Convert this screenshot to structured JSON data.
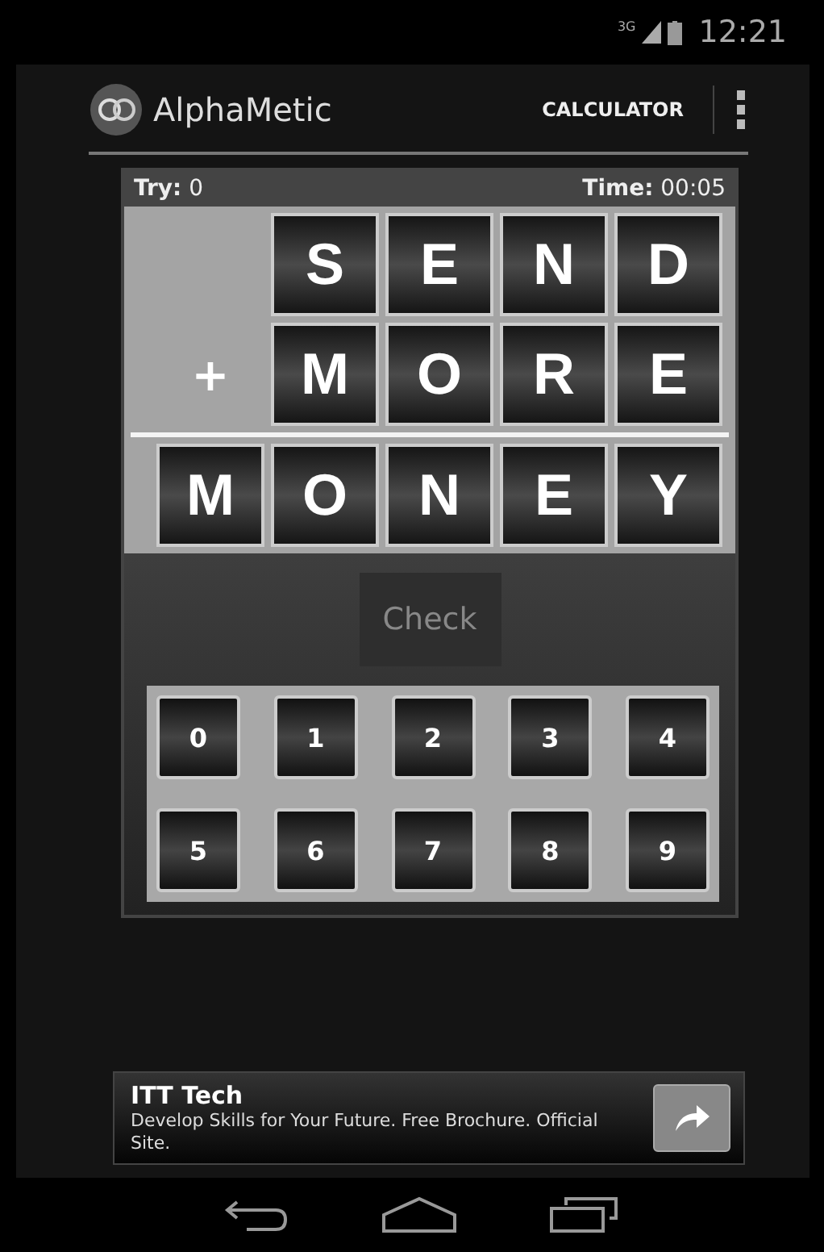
{
  "status_bar": {
    "network": "3G",
    "time": "12:21"
  },
  "action_bar": {
    "title": "AlphaMetic",
    "action": "CALCULATOR"
  },
  "game": {
    "try_label": "Try:",
    "try_value": "0",
    "time_label": "Time:",
    "time_value": "00:05",
    "operator": "+",
    "rows": [
      [
        "",
        "S",
        "E",
        "N",
        "D"
      ],
      [
        "",
        "M",
        "O",
        "R",
        "E"
      ],
      [
        "M",
        "O",
        "N",
        "E",
        "Y"
      ]
    ],
    "check_button": {
      "label": "Check",
      "disabled": true
    },
    "digits": [
      "0",
      "1",
      "2",
      "3",
      "4",
      "5",
      "6",
      "7",
      "8",
      "9"
    ]
  },
  "ad": {
    "title": "ITT Tech",
    "text": "Develop Skills for Your Future. Free Brochure. Official Site."
  }
}
